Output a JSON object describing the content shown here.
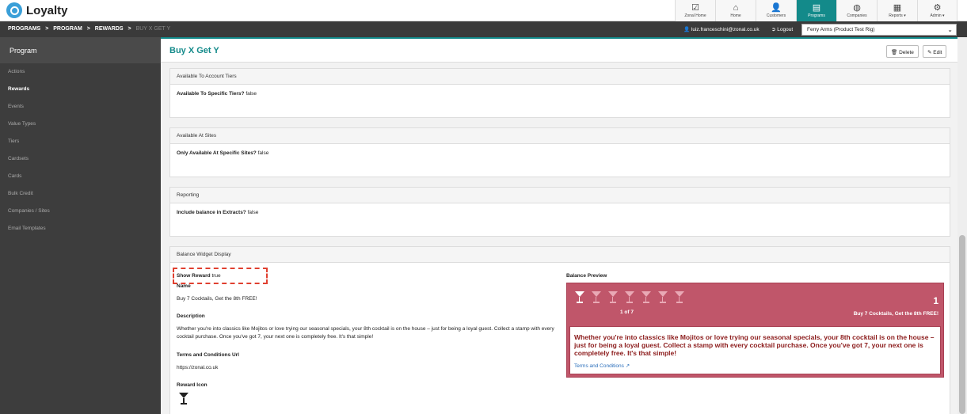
{
  "app": {
    "name": "Loyalty"
  },
  "nav": {
    "tabs": [
      {
        "label": "Zonal Home",
        "icon": "check-icon",
        "glyph": "☑"
      },
      {
        "label": "Home",
        "icon": "home-icon",
        "glyph": "⌂"
      },
      {
        "label": "Customers",
        "icon": "user-icon",
        "glyph": "👤"
      },
      {
        "label": "Programs",
        "icon": "book-icon",
        "glyph": "▤"
      },
      {
        "label": "Companies",
        "icon": "globe-icon",
        "glyph": "◍"
      },
      {
        "label": "Reports ▾",
        "icon": "document-icon",
        "glyph": "▦"
      },
      {
        "label": "Admin ▾",
        "icon": "gear-icon",
        "glyph": "⚙"
      }
    ],
    "active_index": 3,
    "active_color": "#138a8a"
  },
  "breadcrumb": {
    "items": [
      "PROGRAMS",
      "PROGRAM",
      "REWARDS"
    ],
    "current": "BUY X GET Y",
    "separator": ">"
  },
  "user": {
    "email": "luiz.franceschini@zonal.co.uk",
    "logout_label": "Logout"
  },
  "site_select": {
    "value": "Ferry Arms (Product Test Rig)"
  },
  "sidebar": {
    "title": "Program",
    "items": [
      "Actions",
      "Rewards",
      "Events",
      "Value Types",
      "Tiers",
      "Cardsets",
      "Cards",
      "Bulk Credit",
      "Companies / Sites",
      "Email Templates"
    ],
    "active_index": 1
  },
  "page": {
    "title": "Buy X Get Y",
    "delete_label": "Delete",
    "edit_label": "Edit"
  },
  "panels": {
    "tiers": {
      "title": "Available To Account Tiers",
      "field": "Available To Specific Tiers?",
      "value": "false"
    },
    "sites": {
      "title": "Available At Sites",
      "field": "Only Available At Specific Sites?",
      "value": "false"
    },
    "reporting": {
      "title": "Reporting",
      "field": "Include balance in Extracts?",
      "value": "false"
    },
    "widget": {
      "title": "Balance Widget Display",
      "show_reward_label": "Show Reward",
      "show_reward_value": "true",
      "name_label": "Name",
      "name_value": "Buy 7 Cocktails, Get the 8th FREE!",
      "description_label": "Description",
      "description_value": "Whether you're into classics like Mojitos or love trying our seasonal specials, your 8th cocktail is on the house – just for being a loyal guest. Collect a stamp with every cocktail purchase. Once you've got 7, your next one is completely free. It's that simple!",
      "terms_label": "Terms and Conditions Url",
      "terms_value": "https://zonal.co.uk",
      "icon_label": "Reward Icon",
      "icon_name": "cocktail-icon",
      "preview_label": "Balance Preview",
      "preview": {
        "stamps_total": 7,
        "stamps_filled": 1,
        "counter": "1 of 7",
        "balance": "1",
        "name": "Buy 7 Cocktails, Get the 8th FREE!",
        "description": "Whether you're into classics like Mojitos or love trying our seasonal specials, your 8th cocktail is on the house – just for being a loyal guest. Collect a stamp with every cocktail purchase. Once you've got 7, your next one is completely free. It's that simple!",
        "terms_link": "Terms and Conditions",
        "bg_color": "#c0566a",
        "text_color": "#8b1a1a"
      }
    }
  }
}
